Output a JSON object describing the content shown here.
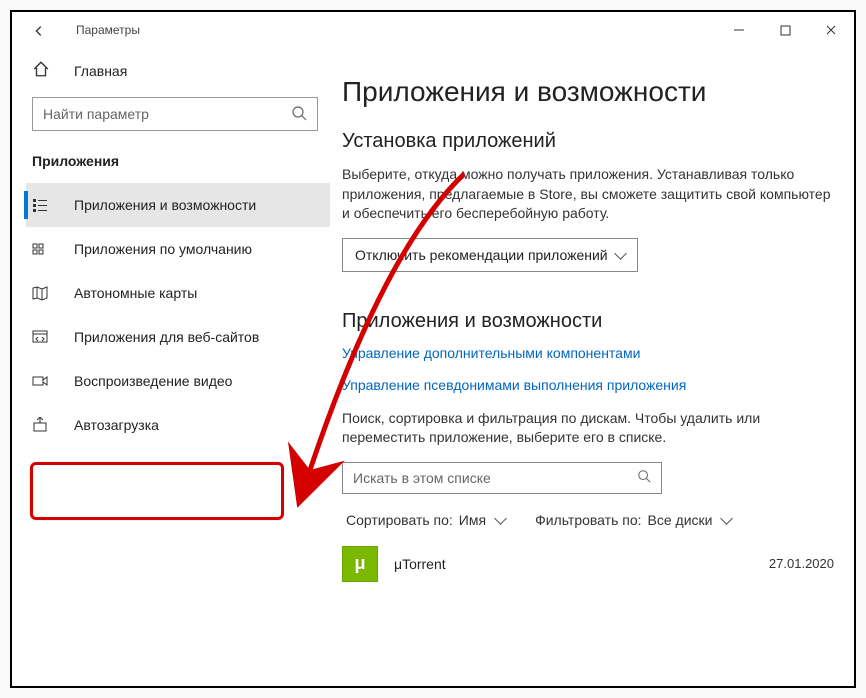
{
  "window": {
    "title": "Параметры"
  },
  "sidebar": {
    "home": "Главная",
    "search_placeholder": "Найти параметр",
    "section": "Приложения",
    "items": [
      {
        "label": "Приложения и возможности"
      },
      {
        "label": "Приложения по умолчанию"
      },
      {
        "label": "Автономные карты"
      },
      {
        "label": "Приложения для веб-сайтов"
      },
      {
        "label": "Воспроизведение видео"
      },
      {
        "label": "Автозагрузка"
      }
    ]
  },
  "main": {
    "page_title": "Приложения и возможности",
    "install": {
      "heading": "Установка приложений",
      "desc": "Выберите, откуда можно получать приложения. Устанавливая только приложения, предлагаемые в Store, вы сможете защитить свой компьютер и обеспечить его бесперебойную работу.",
      "dropdown_value": "Отключить рекомендации приложений"
    },
    "apps_section": {
      "heading": "Приложения и возможности",
      "link1": "Управление дополнительными компонентами",
      "link2": "Управление псевдонимами выполнения приложения",
      "desc2": "Поиск, сортировка и фильтрация по дискам. Чтобы удалить или переместить приложение, выберите его в списке.",
      "search_placeholder2": "Искать в этом списке",
      "sort_label": "Сортировать по:",
      "sort_value": "Имя",
      "filter_label": "Фильтровать по:",
      "filter_value": "Все диски",
      "apps": [
        {
          "name": "μTorrent",
          "date": "27.01.2020"
        }
      ]
    }
  }
}
